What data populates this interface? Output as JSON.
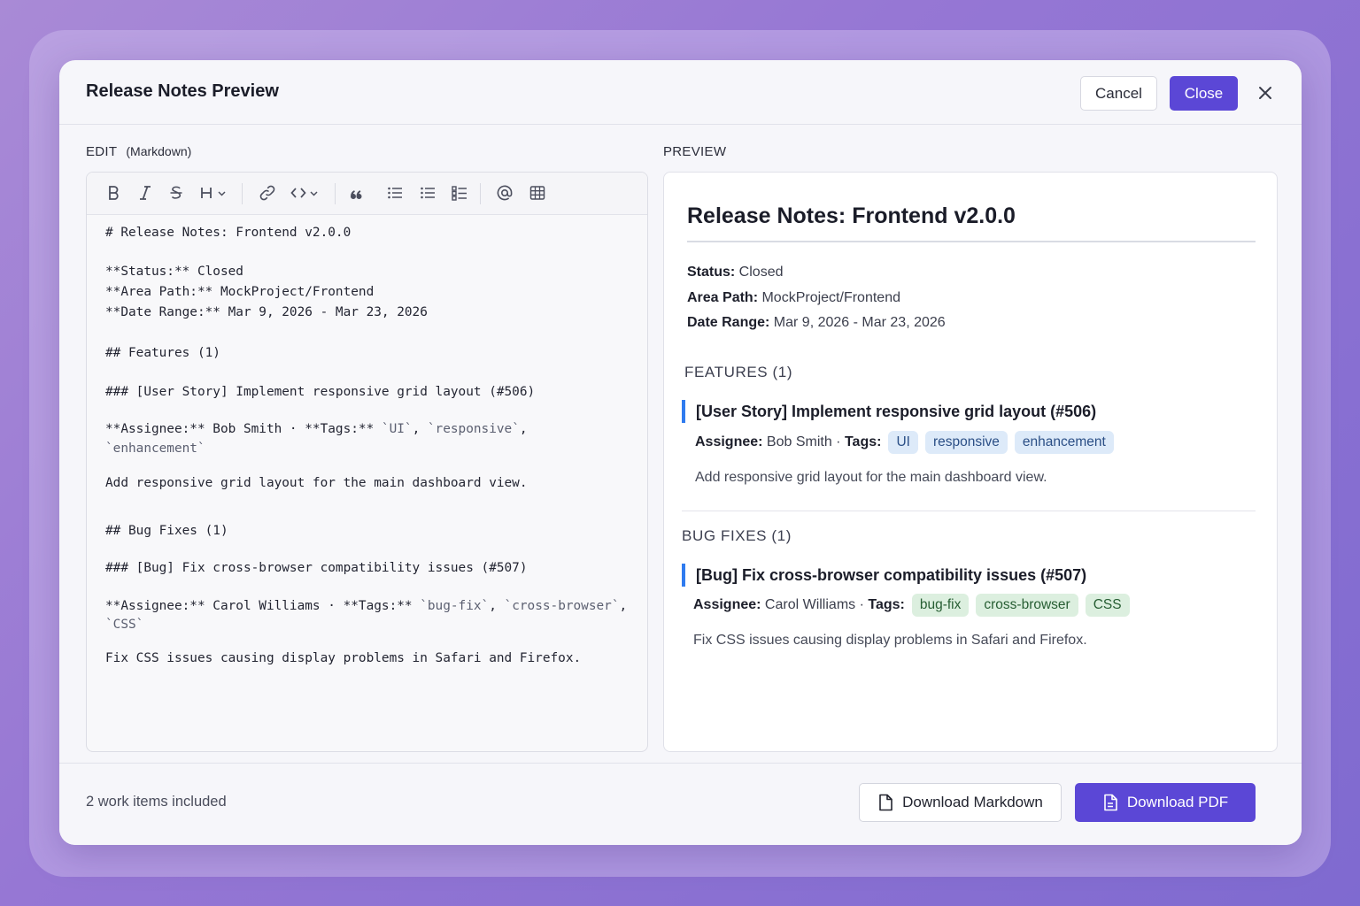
{
  "header": {
    "title": "Release Notes Preview",
    "cancel_label": "Cancel",
    "close_label": "Close",
    "close_icon": "x-icon"
  },
  "editor": {
    "label": "EDIT",
    "sublabel": "(Markdown)",
    "toolbar": [
      "bold-icon",
      "italic-icon",
      "strikethrough-icon",
      "heading-icon",
      "link-icon",
      "code-icon",
      "quote-icon",
      "bulleted-list-icon",
      "numbered-list-icon",
      "checklist-icon",
      "mention-icon",
      "table-icon"
    ],
    "lines": [
      "# Release Notes: Frontend v2.0.0",
      "**Status:** Closed",
      "**Area Path:** MockProject/Frontend",
      "**Date Range:** Mar 9, 2026 - Mar 23, 2026",
      "## Features (1)",
      "### [User Story] Implement responsive grid layout (#506)",
      "**Assignee:** Bob Smith · **Tags:** ",
      "`UI`",
      ", ",
      "`responsive`",
      ",",
      "`enhancement`",
      "Add responsive grid layout for the main dashboard view.",
      "## Bug Fixes (1)",
      "### [Bug] Fix cross-browser compatibility issues (#507)",
      "**Assignee:** Carol Williams · **Tags:** ",
      "`bug-fix`",
      ", ",
      "`cross-browser`",
      ",",
      "`CSS`",
      "Fix CSS issues causing display problems in Safari and Firefox."
    ]
  },
  "preview": {
    "label": "PREVIEW",
    "title": "Release Notes: Frontend v2.0.0",
    "status_label": "Status:",
    "status_value": " Closed",
    "area_label": "Area Path:",
    "area_value": " MockProject/Frontend",
    "date_label": "Date Range:",
    "date_value": " Mar 9, 2026 - Mar 23, 2026",
    "features_heading": "FEATURES (1)",
    "feature_title": "[User Story] Implement responsive grid layout (#506)",
    "feature_assignee_label": "Assignee:",
    "feature_assignee": " Bob Smith · ",
    "tags_label": "Tags:",
    "feature_tags": [
      "UI",
      "responsive",
      "enhancement"
    ],
    "feature_desc": "Add responsive grid layout for the main dashboard view.",
    "bugs_heading": "BUG FIXES (1)",
    "bug_title": "[Bug] Fix cross-browser compatibility issues (#507)",
    "bug_assignee_label": "Assignee:",
    "bug_assignee": " Carol Williams · ",
    "bug_tags": [
      "bug-fix",
      "cross-browser",
      "CSS"
    ],
    "bug_desc": "Fix CSS issues causing display problems in Safari and Firefox."
  },
  "footer": {
    "count_text": "2 work items included",
    "download_md_label": "Download Markdown",
    "download_pdf_label": "Download PDF"
  },
  "colors": {
    "accent": "#5b47d6",
    "item_bar": "#2f7bef",
    "tag_blue_bg": "#ddeaf9",
    "tag_green_bg": "#dcefdf"
  }
}
